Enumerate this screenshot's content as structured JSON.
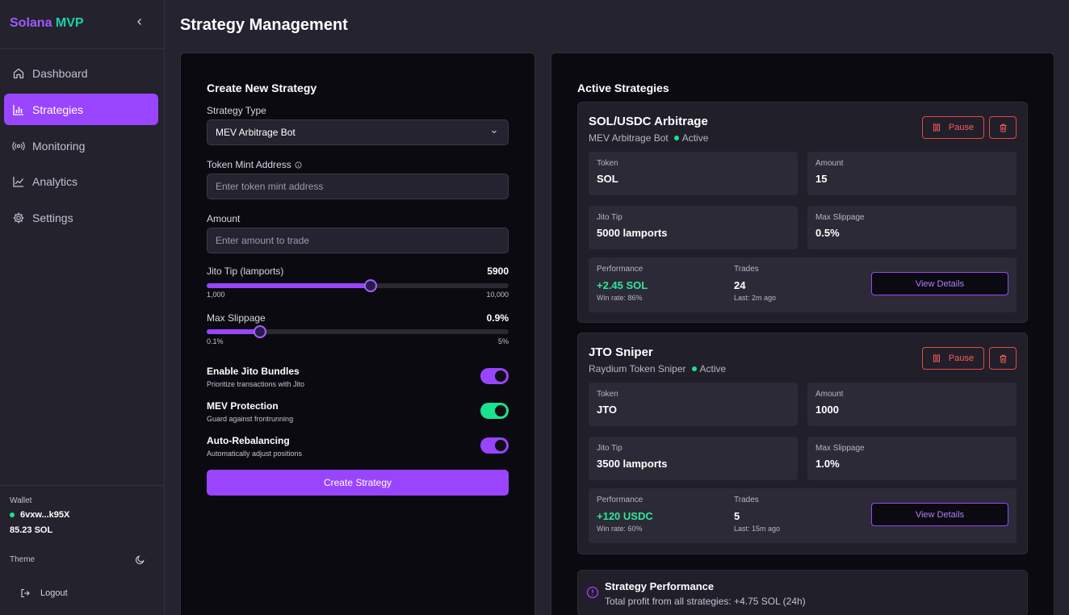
{
  "brand": {
    "part1": "Solana",
    "part2": "MVP"
  },
  "sidebar": {
    "items": [
      {
        "label": "Dashboard",
        "icon": "home-icon"
      },
      {
        "label": "Strategies",
        "icon": "bar-chart-icon",
        "active": true
      },
      {
        "label": "Monitoring",
        "icon": "radio-waves-icon"
      },
      {
        "label": "Analytics",
        "icon": "line-chart-icon"
      },
      {
        "label": "Settings",
        "icon": "gear-icon"
      }
    ],
    "wallet_label": "Wallet",
    "wallet_address": "6vxw...k95X",
    "wallet_balance": "85.23 SOL",
    "theme_label": "Theme",
    "logout_label": "Logout"
  },
  "page": {
    "title": "Strategy Management"
  },
  "create_form": {
    "title": "Create New Strategy",
    "strategy_type_label": "Strategy Type",
    "strategy_type_value": "MEV Arbitrage Bot",
    "token_mint_label": "Token Mint Address",
    "token_mint_placeholder": "Enter token mint address",
    "amount_label": "Amount",
    "amount_placeholder": "Enter amount to trade",
    "jito_tip": {
      "label": "Jito Tip (lamports)",
      "value": "5900",
      "min": "1,000",
      "max": "10,000",
      "fraction": 0.544
    },
    "max_slippage": {
      "label": "Max Slippage",
      "value": "0.9%",
      "min": "0.1%",
      "max": "5%",
      "fraction": 0.176
    },
    "toggles": [
      {
        "title": "Enable Jito Bundles",
        "desc": "Prioritize transactions with Jito",
        "on": true,
        "color": "#9945ff"
      },
      {
        "title": "MEV Protection",
        "desc": "Guard against frontrunning",
        "on": true,
        "color": "#19e38e"
      },
      {
        "title": "Auto-Rebalancing",
        "desc": "Automatically adjust positions",
        "on": true,
        "color": "#9945ff"
      }
    ],
    "submit_label": "Create Strategy"
  },
  "active": {
    "title": "Active Strategies",
    "strategies": [
      {
        "name": "SOL/USDC Arbitrage",
        "type": "MEV Arbitrage Bot",
        "status": "Active",
        "pause_label": "Pause",
        "token_label": "Token",
        "token": "SOL",
        "amount_label": "Amount",
        "amount": "15",
        "jito_label": "Jito Tip",
        "jito": "5000 lamports",
        "slippage_label": "Max Slippage",
        "slippage": "0.5%",
        "performance_label": "Performance",
        "performance": "+2.45 SOL",
        "win_rate": "Win rate: 86%",
        "trades_label": "Trades",
        "trades": "24",
        "last": "Last: 2m ago",
        "details_label": "View Details"
      },
      {
        "name": "JTO Sniper",
        "type": "Raydium Token Sniper",
        "status": "Active",
        "pause_label": "Pause",
        "token_label": "Token",
        "token": "JTO",
        "amount_label": "Amount",
        "amount": "1000",
        "jito_label": "Jito Tip",
        "jito": "3500 lamports",
        "slippage_label": "Max Slippage",
        "slippage": "1.0%",
        "performance_label": "Performance",
        "performance": "+120 USDC",
        "win_rate": "Win rate: 60%",
        "trades_label": "Trades",
        "trades": "5",
        "last": "Last: 15m ago",
        "details_label": "View Details"
      }
    ],
    "summary_title": "Strategy Performance",
    "summary_text": "Total profit from all strategies: +4.75 SOL (24h)"
  },
  "colors": {
    "accent": "#9945ff",
    "success": "#19e38e",
    "danger": "#e34a4a",
    "profit": "#2ee89a"
  }
}
